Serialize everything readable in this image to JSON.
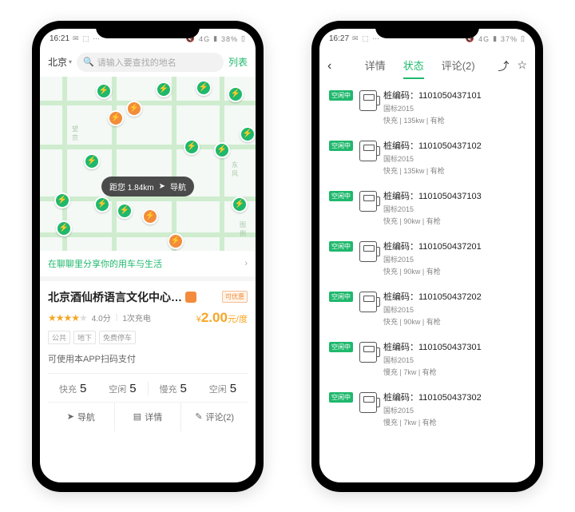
{
  "left": {
    "statusbar": {
      "time": "16:21",
      "battery": "38%",
      "net": "4G"
    },
    "city": "北京",
    "search_placeholder": "请输入要查找的地名",
    "list_link": "列表",
    "distance_bubble": {
      "dist": "距您 1.84km",
      "nav": "导航"
    },
    "share_text": "在聊聊里分享你的用车与生活",
    "station": {
      "title": "北京酒仙桥语言文化中心…",
      "promo": "可优惠",
      "rating_score": "4.0分",
      "usage": "1次充电",
      "price_value": "2.00",
      "price_unit": "元/度",
      "price_symbol": "¥",
      "tags": [
        "公共",
        "地下",
        "免费停车"
      ],
      "note": "可使用本APP扫码支付",
      "counts": [
        {
          "label": "快充",
          "n": "5"
        },
        {
          "label": "空闲",
          "n": "5"
        },
        {
          "label": "慢充",
          "n": "5"
        },
        {
          "label": "空闲",
          "n": "5"
        }
      ],
      "actions": {
        "nav": "导航",
        "detail": "详情",
        "comments": "评论(2)"
      }
    }
  },
  "right": {
    "statusbar": {
      "time": "16:27",
      "battery": "37%",
      "net": "4G"
    },
    "tabs": {
      "detail": "详情",
      "status": "状态",
      "comments": "评论(2)"
    },
    "badge": "空闲中",
    "code_label": "桩编码：",
    "stubs": [
      {
        "code": "1101050437101",
        "std": "国标2015",
        "spec": "快充 | 135kw | 有枪"
      },
      {
        "code": "1101050437102",
        "std": "国标2015",
        "spec": "快充 | 135kw | 有枪"
      },
      {
        "code": "1101050437103",
        "std": "国标2015",
        "spec": "快充 | 90kw | 有枪"
      },
      {
        "code": "1101050437201",
        "std": "国标2015",
        "spec": "快充 | 90kw | 有枪"
      },
      {
        "code": "1101050437202",
        "std": "国标2015",
        "spec": "快充 | 90kw | 有枪"
      },
      {
        "code": "1101050437301",
        "std": "国标2015",
        "spec": "慢充 | 7kw | 有枪"
      },
      {
        "code": "1101050437302",
        "std": "国标2015",
        "spec": "慢充 | 7kw | 有枪"
      }
    ]
  }
}
